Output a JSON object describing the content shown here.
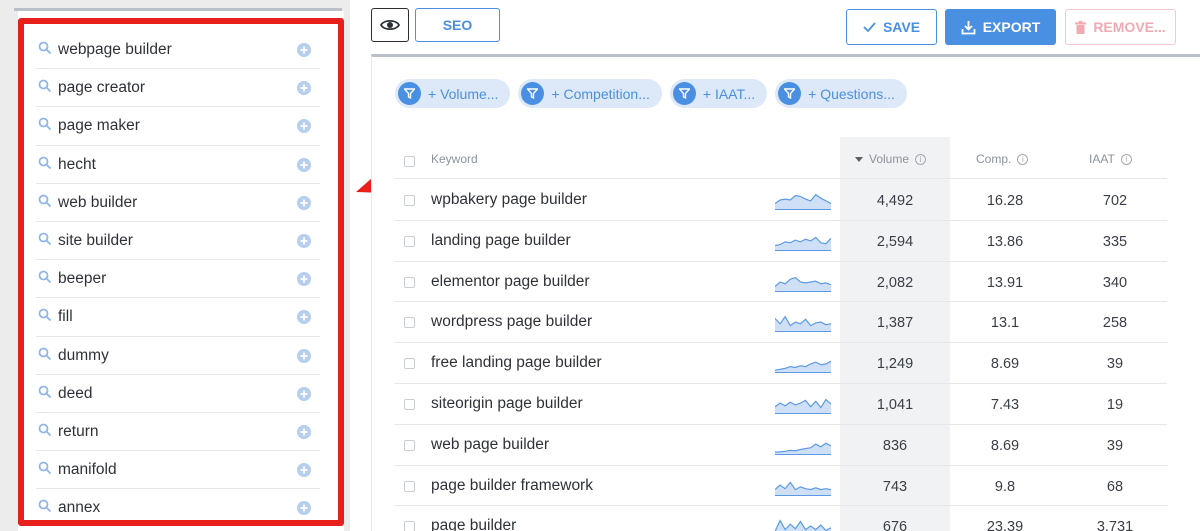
{
  "left_panel": {
    "suggestions": [
      {
        "label": "webpage builder"
      },
      {
        "label": "page creator"
      },
      {
        "label": "page maker"
      },
      {
        "label": "hecht"
      },
      {
        "label": "web builder"
      },
      {
        "label": "site builder"
      },
      {
        "label": "beeper"
      },
      {
        "label": "fill"
      },
      {
        "label": "dummy"
      },
      {
        "label": "deed"
      },
      {
        "label": "return"
      },
      {
        "label": "manifold"
      },
      {
        "label": "annex"
      }
    ]
  },
  "toolbar": {
    "view_icon": "eye-icon",
    "seo_label": "SEO",
    "save_label": "SAVE",
    "export_label": "EXPORT",
    "remove_label": "REMOVE..."
  },
  "filters": [
    {
      "label": "+ Volume..."
    },
    {
      "label": "+ Competition..."
    },
    {
      "label": "+ IAAT..."
    },
    {
      "label": "+ Questions..."
    }
  ],
  "table": {
    "headers": {
      "keyword": "Keyword",
      "volume": "Volume",
      "comp": "Comp.",
      "iaat": "IAAT"
    },
    "sort": {
      "column": "volume",
      "direction": "descending"
    },
    "rows": [
      {
        "keyword": "wpbakery page builder",
        "volume": "4,492",
        "comp": "16.28",
        "iaat": "702",
        "trend": [
          0.3,
          0.5,
          0.55,
          0.5,
          0.75,
          0.7,
          0.55,
          0.45,
          0.8,
          0.6,
          0.45,
          0.3
        ]
      },
      {
        "keyword": "landing page builder",
        "volume": "2,594",
        "comp": "13.86",
        "iaat": "335",
        "trend": [
          0.25,
          0.3,
          0.45,
          0.4,
          0.55,
          0.45,
          0.6,
          0.5,
          0.7,
          0.4,
          0.35,
          0.65
        ]
      },
      {
        "keyword": "elementor page builder",
        "volume": "2,082",
        "comp": "13.91",
        "iaat": "340",
        "trend": [
          0.25,
          0.5,
          0.4,
          0.65,
          0.75,
          0.5,
          0.45,
          0.5,
          0.55,
          0.4,
          0.45,
          0.35
        ]
      },
      {
        "keyword": "wordpress page builder",
        "volume": "1,387",
        "comp": "13.1",
        "iaat": "258",
        "trend": [
          0.7,
          0.4,
          0.8,
          0.3,
          0.5,
          0.4,
          0.65,
          0.3,
          0.45,
          0.5,
          0.35,
          0.4
        ]
      },
      {
        "keyword": "free landing page builder",
        "volume": "1,249",
        "comp": "8.69",
        "iaat": "39",
        "trend": [
          0.1,
          0.15,
          0.2,
          0.3,
          0.25,
          0.35,
          0.3,
          0.45,
          0.55,
          0.4,
          0.45,
          0.6
        ]
      },
      {
        "keyword": "siteorigin page builder",
        "volume": "1,041",
        "comp": "7.43",
        "iaat": "19",
        "trend": [
          0.35,
          0.55,
          0.4,
          0.6,
          0.45,
          0.55,
          0.7,
          0.35,
          0.65,
          0.3,
          0.75,
          0.5
        ]
      },
      {
        "keyword": "web page builder",
        "volume": "836",
        "comp": "8.69",
        "iaat": "39",
        "trend": [
          0.1,
          0.12,
          0.15,
          0.2,
          0.18,
          0.25,
          0.3,
          0.35,
          0.55,
          0.4,
          0.6,
          0.45
        ]
      },
      {
        "keyword": "page builder framework",
        "volume": "743",
        "comp": "9.8",
        "iaat": "68",
        "trend": [
          0.3,
          0.55,
          0.35,
          0.7,
          0.3,
          0.45,
          0.35,
          0.3,
          0.4,
          0.3,
          0.35,
          0.3
        ]
      },
      {
        "keyword": "page builder",
        "volume": "676",
        "comp": "23.39",
        "iaat": "3,731",
        "trend": [
          0.2,
          0.8,
          0.3,
          0.6,
          0.35,
          0.75,
          0.3,
          0.5,
          0.3,
          0.55,
          0.25,
          0.4
        ]
      }
    ]
  },
  "colors": {
    "accent": "#4a90e2",
    "highlight": "#e8201b",
    "chip_bg": "#dde9f8",
    "remove_disabled": "#f1a9b2",
    "sparkline_fill": "#cfe0f6"
  }
}
